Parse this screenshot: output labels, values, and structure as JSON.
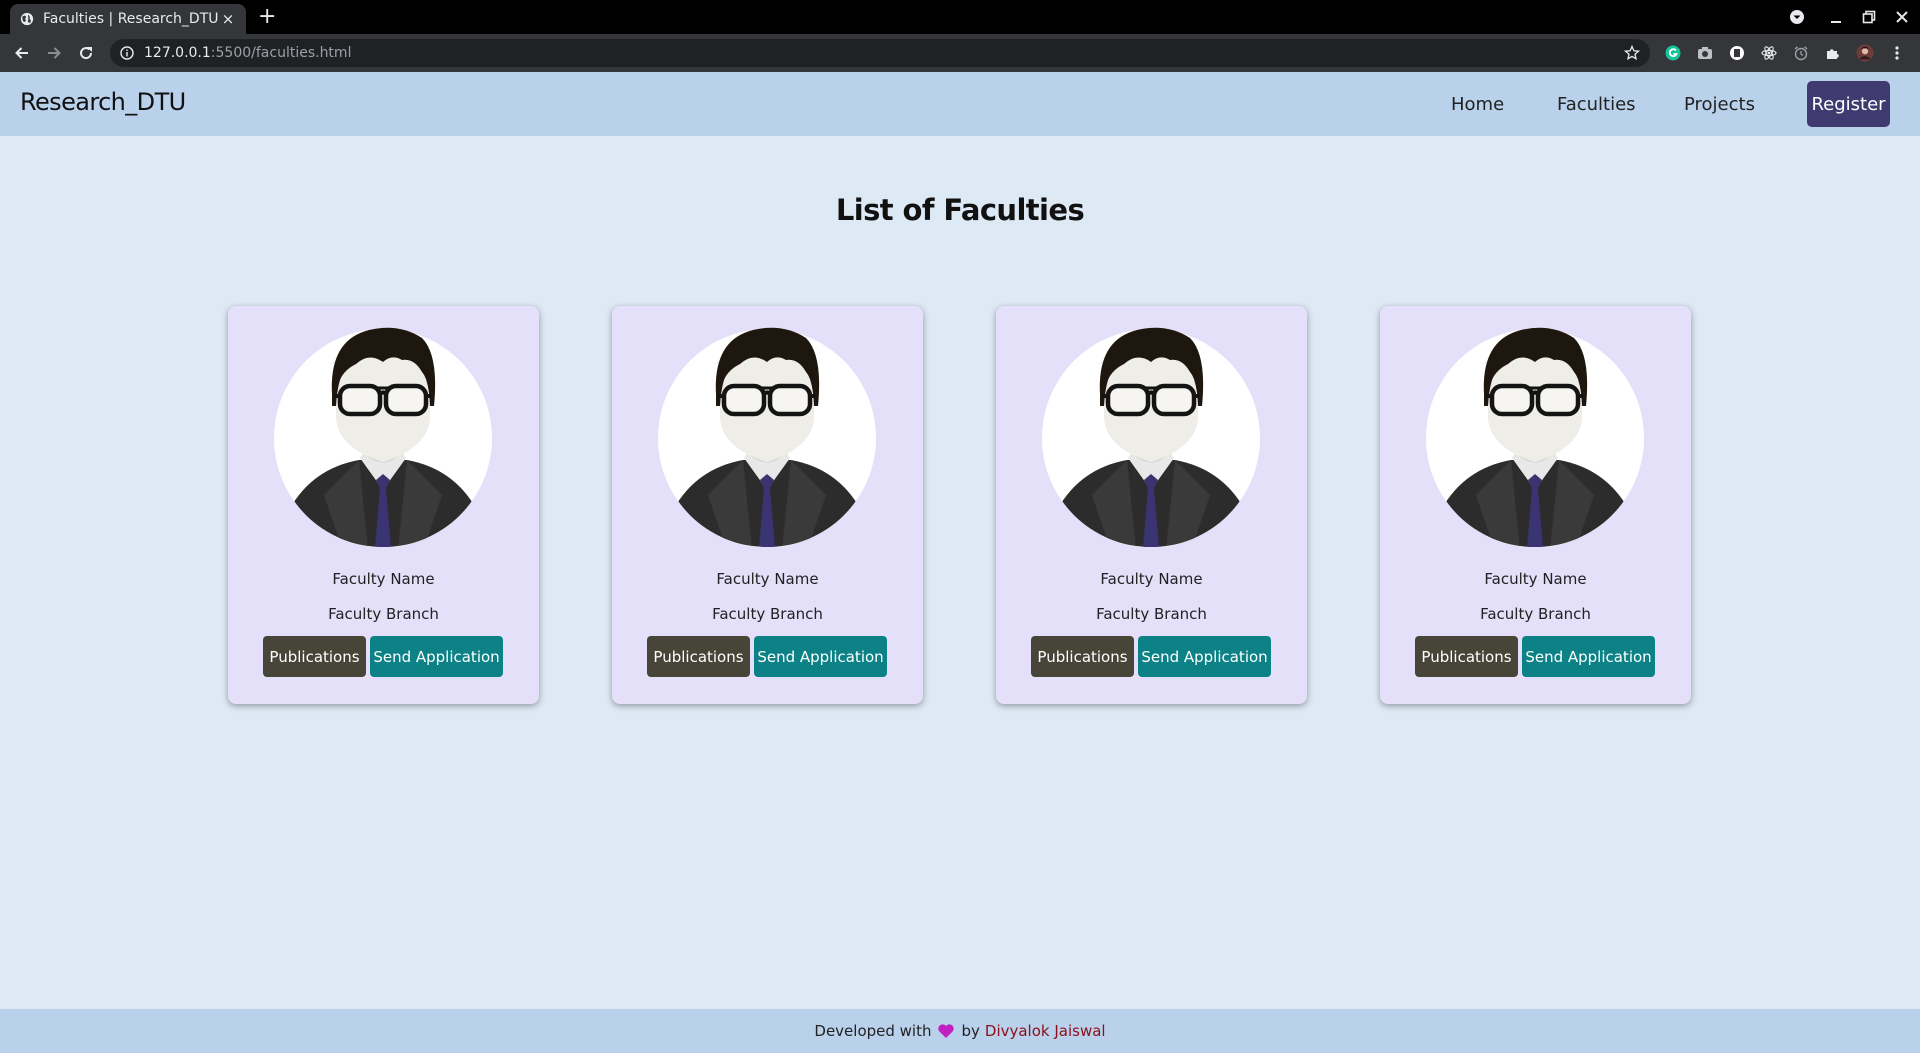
{
  "browser": {
    "tab_title": "Faculties | Research_DTU",
    "tab_close": "×",
    "new_tab": "+",
    "url_host": "127.0.0.1",
    "url_path": ":5500/faculties.html"
  },
  "nav": {
    "brand": "Research_DTU",
    "links": [
      "Home",
      "Faculties",
      "Projects"
    ],
    "register": "Register"
  },
  "main": {
    "title": "List of Faculties",
    "faculty_cards": [
      {
        "name": "Faculty Name",
        "branch": "Faculty Branch",
        "publications_label": "Publications",
        "send_label": "Send Application"
      },
      {
        "name": "Faculty Name",
        "branch": "Faculty Branch",
        "publications_label": "Publications",
        "send_label": "Send Application"
      },
      {
        "name": "Faculty Name",
        "branch": "Faculty Branch",
        "publications_label": "Publications",
        "send_label": "Send Application"
      },
      {
        "name": "Faculty Name",
        "branch": "Faculty Branch",
        "publications_label": "Publications",
        "send_label": "Send Application"
      }
    ]
  },
  "footer": {
    "prefix": "Developed with",
    "by": "by",
    "author": "Divyalok Jaiswal",
    "heart_color": "#c21fc0"
  },
  "colors": {
    "nav_bg": "#bad1eb",
    "page_bg": "#dde9f5",
    "card_bg": "#e4e0fa",
    "register_bg": "#3f3a70",
    "publications_bg": "#464538",
    "send_bg": "#0c8287",
    "author_link": "#8b0f1a"
  },
  "icons": [
    "globe-icon",
    "info-icon",
    "star-icon",
    "back-arrow-icon",
    "forward-arrow-icon",
    "reload-icon",
    "grammarly-icon",
    "camera-icon",
    "extension-icon",
    "puzzle-icon",
    "profile-avatar-icon",
    "menu-dots-icon",
    "heart-icon",
    "faculty-avatar-icon"
  ]
}
